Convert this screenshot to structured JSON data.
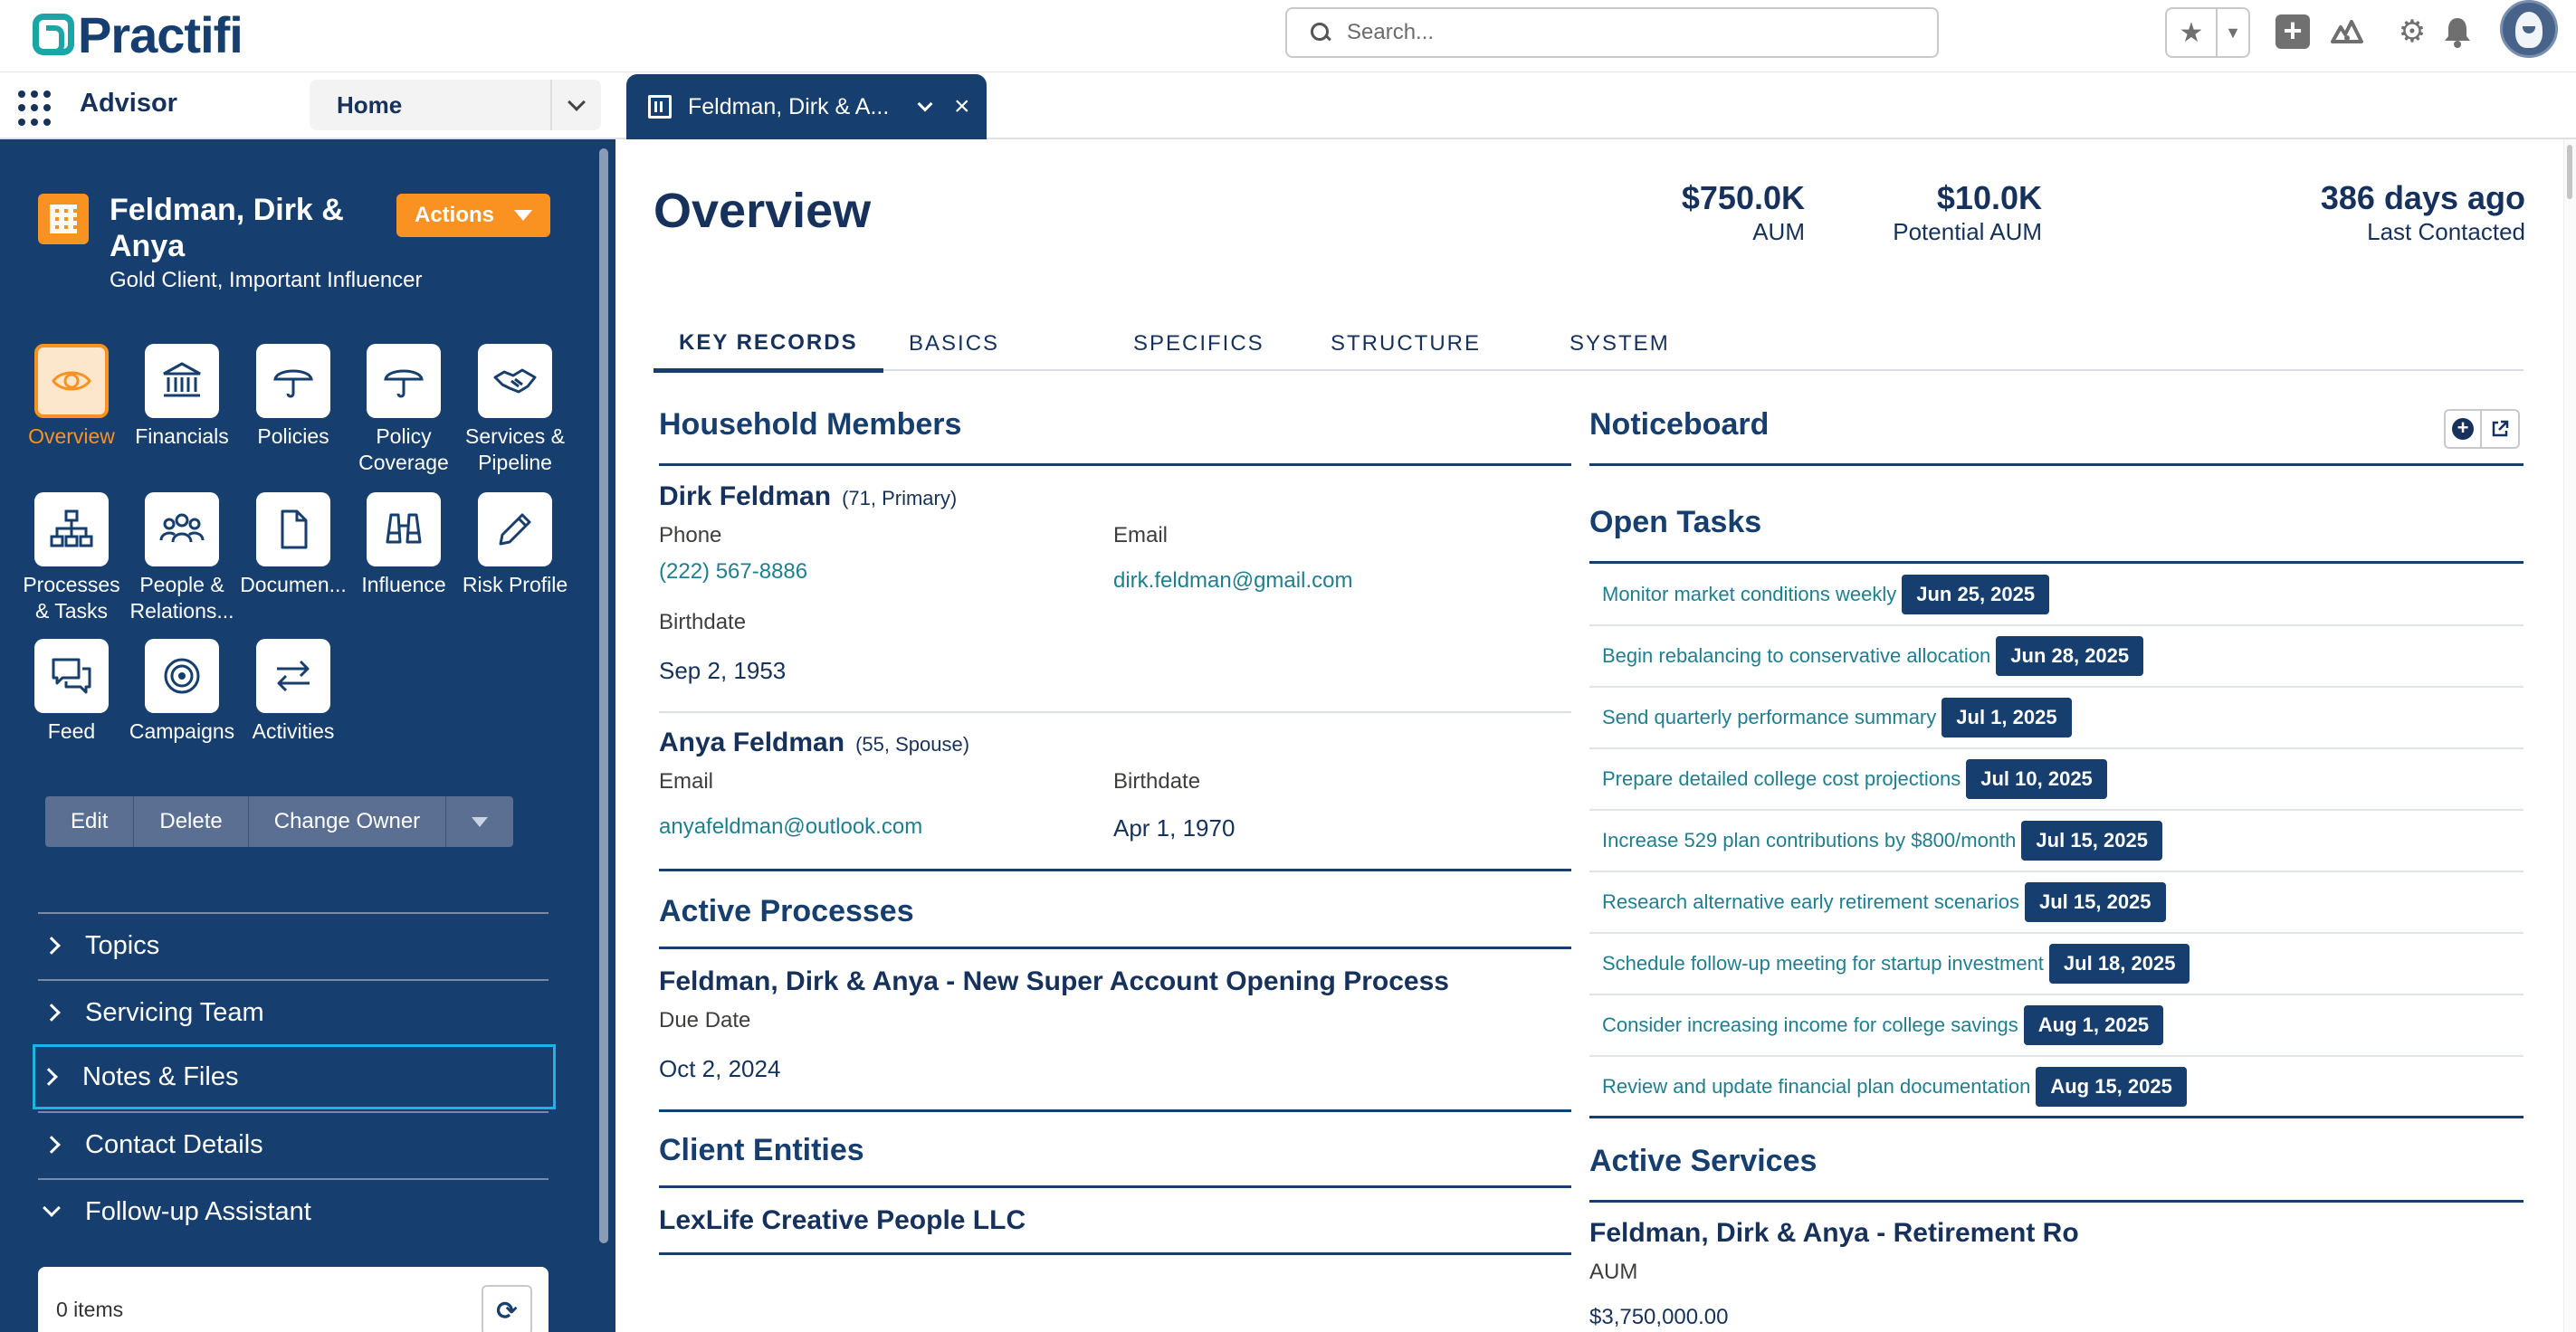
{
  "header": {
    "logo_text": "Practifi",
    "search_placeholder": "Search...",
    "icons": [
      "star-icon",
      "chevron-down-icon",
      "add-icon",
      "trailhead-icon",
      "gear-icon",
      "bell-icon",
      "avatar"
    ]
  },
  "nav": {
    "app_name": "Advisor",
    "home_select": "Home",
    "tab_label": "Feldman, Dirk & A...",
    "tab_close": "×"
  },
  "sidebar": {
    "record_name": "Feldman, Dirk & Anya",
    "record_sub": "Gold Client, Important Influencer",
    "actions_label": "Actions",
    "tiles": [
      {
        "label": "Overview",
        "icon": "eye-icon",
        "selected": true
      },
      {
        "label": "Financials",
        "icon": "bank-icon"
      },
      {
        "label": "Policies",
        "icon": "umbrella-icon"
      },
      {
        "label": "Policy Coverage",
        "icon": "umbrella-icon"
      },
      {
        "label": "Services & Pipeline",
        "icon": "handshake-icon"
      },
      {
        "label": "Processes & Tasks",
        "icon": "hierarchy-icon"
      },
      {
        "label": "People & Relations...",
        "icon": "people-icon"
      },
      {
        "label": "Documen...",
        "icon": "document-icon"
      },
      {
        "label": "Influence",
        "icon": "binoculars-icon"
      },
      {
        "label": "Risk Profile",
        "icon": "pencil-icon"
      },
      {
        "label": "Feed",
        "icon": "chat-icon"
      },
      {
        "label": "Campaigns",
        "icon": "target-icon"
      },
      {
        "label": "Activities",
        "icon": "swap-icon"
      }
    ],
    "buttons": {
      "edit": "Edit",
      "delete": "Delete",
      "change_owner": "Change Owner"
    },
    "accordion": [
      {
        "label": "Topics"
      },
      {
        "label": "Servicing Team"
      },
      {
        "label": "Notes & Files"
      },
      {
        "label": "Contact Details"
      },
      {
        "label": "Follow-up Assistant"
      }
    ],
    "followup_count": "0 items"
  },
  "main": {
    "title": "Overview",
    "stats": [
      {
        "value": "$750.0K",
        "label": "AUM"
      },
      {
        "value": "$10.0K",
        "label": "Potential AUM"
      },
      {
        "value": "386 days ago",
        "label": "Last Contacted"
      }
    ],
    "tabs": [
      "KEY RECORDS",
      "BASICS",
      "SPECIFICS",
      "STRUCTURE",
      "SYSTEM"
    ],
    "household": {
      "heading": "Household Members",
      "members": [
        {
          "name": "Dirk Feldman",
          "meta": "(71, Primary)",
          "phone_label": "Phone",
          "phone": "(222) 567-8886",
          "email_label": "Email",
          "email": "dirk.feldman@gmail.com",
          "birth_label": "Birthdate",
          "birthdate": "Sep 2, 1953"
        },
        {
          "name": "Anya Feldman",
          "meta": "(55, Spouse)",
          "email_label": "Email",
          "email": "anyafeldman@outlook.com",
          "birth_label": "Birthdate",
          "birthdate": "Apr 1, 1970"
        }
      ]
    },
    "processes": {
      "heading": "Active Processes",
      "name": "Feldman, Dirk & Anya - New Super Account Opening Process",
      "due_label": "Due Date",
      "due": "Oct 2, 2024"
    },
    "entities": {
      "heading": "Client Entities",
      "name": "LexLife Creative People LLC"
    },
    "noticeboard": {
      "heading": "Noticeboard"
    },
    "open_tasks": {
      "heading": "Open Tasks",
      "items": [
        {
          "text": "Monitor market conditions weekly",
          "date": "Jun 25, 2025"
        },
        {
          "text": "Begin rebalancing to conservative allocation",
          "date": "Jun 28, 2025"
        },
        {
          "text": "Send quarterly performance summary",
          "date": "Jul 1, 2025"
        },
        {
          "text": "Prepare detailed college cost projections",
          "date": "Jul 10, 2025"
        },
        {
          "text": "Increase 529 plan contributions by $800/month",
          "date": "Jul 15, 2025"
        },
        {
          "text": "Research alternative early retirement scenarios",
          "date": "Jul 15, 2025"
        },
        {
          "text": "Schedule follow-up meeting for startup investment",
          "date": "Jul 18, 2025"
        },
        {
          "text": "Consider increasing income for college savings",
          "date": "Aug 1, 2025"
        },
        {
          "text": "Review and update financial plan documentation",
          "date": "Aug 15, 2025"
        }
      ]
    },
    "services": {
      "heading": "Active Services",
      "name": "Feldman, Dirk & Anya - Retirement Ro",
      "aum_label": "AUM",
      "aum": "$3,750,000.00"
    }
  },
  "colors": {
    "brand_navy": "#163e6e",
    "accent_orange": "#f99221",
    "link_teal": "#1e7f8f",
    "focus_cyan": "#1ab5e6"
  }
}
